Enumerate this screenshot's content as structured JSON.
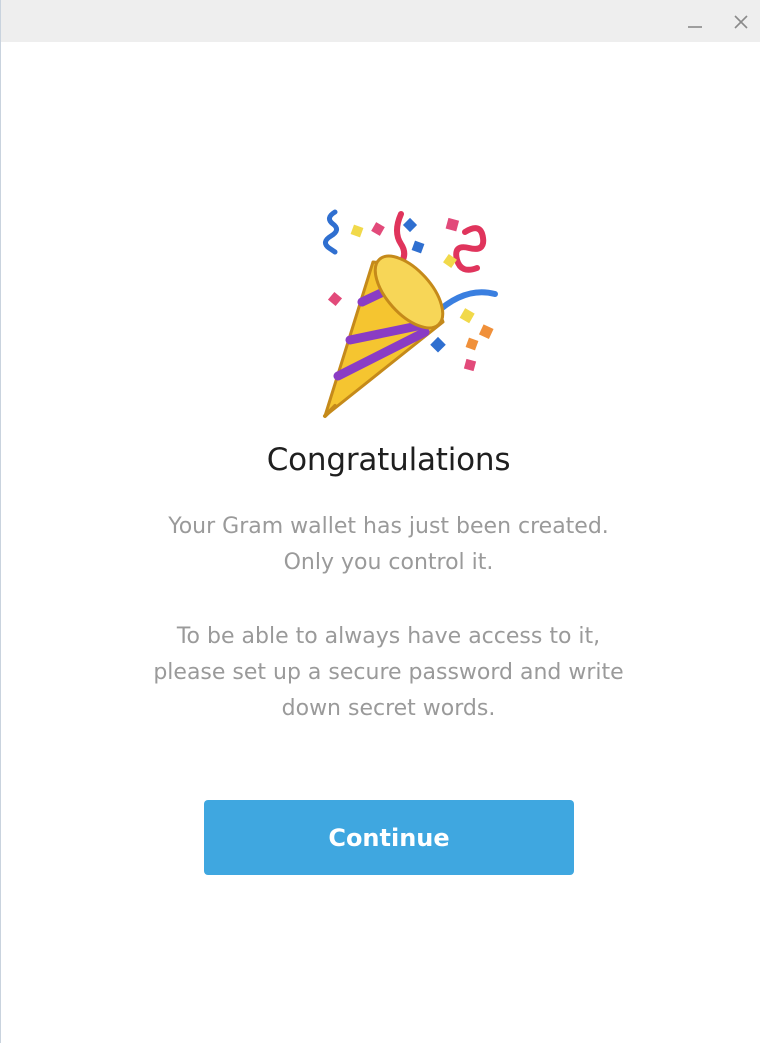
{
  "window": {
    "minimize_icon": "minimize-icon",
    "close_icon": "close-icon"
  },
  "hero": {
    "icon": "party-popper-icon"
  },
  "heading": "Congratulations",
  "message": {
    "line1": "Your Gram wallet has just been created.",
    "line2": "Only you control it.",
    "line3": "To be able to always have access to it,",
    "line4": "please set up a secure password and write",
    "line5": "down secret words."
  },
  "continue_label": "Continue",
  "colors": {
    "accent": "#3fa7e0",
    "title": "#1f1f1f",
    "muted": "#9a9a9a"
  }
}
